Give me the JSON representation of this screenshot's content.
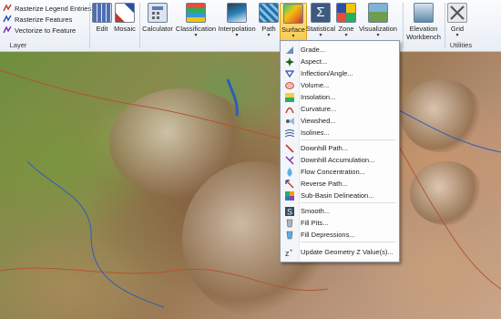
{
  "layer_group": {
    "items": [
      {
        "label": "Rasterize Legend Entries"
      },
      {
        "label": "Rasterize Features"
      },
      {
        "label": "Vectorize to Feature"
      }
    ],
    "group_label": "Layer"
  },
  "ribbon": {
    "buttons": [
      {
        "label": "Edit",
        "dropdown": false
      },
      {
        "label": "Mosaic",
        "dropdown": false
      },
      {
        "label": "Calculator",
        "dropdown": false
      },
      {
        "label": "Classification",
        "dropdown": true
      },
      {
        "label": "Interpolation",
        "dropdown": true
      },
      {
        "label": "Path",
        "dropdown": true
      },
      {
        "label": "Surface",
        "dropdown": true
      },
      {
        "label": "Statistical",
        "dropdown": true
      },
      {
        "label": "Zone",
        "dropdown": true
      },
      {
        "label": "Visualization",
        "dropdown": true
      },
      {
        "label": "Elevation Workbench",
        "dropdown": false
      },
      {
        "label": "Grid",
        "dropdown": true
      }
    ],
    "utilities_label": "Utilities"
  },
  "surface_menu": {
    "items": [
      {
        "label": "Grade...",
        "icon": "grade-icon"
      },
      {
        "label": "Aspect...",
        "icon": "aspect-icon"
      },
      {
        "label": "Inflection/Angle...",
        "icon": "inflection-icon"
      },
      {
        "label": "Volume...",
        "icon": "volume-icon"
      },
      {
        "label": "Insolation...",
        "icon": "insolation-icon"
      },
      {
        "label": "Curvature...",
        "icon": "curvature-icon"
      },
      {
        "label": "Viewshed...",
        "icon": "viewshed-icon"
      },
      {
        "label": "Isolines...",
        "icon": "isolines-icon"
      },
      {
        "label": "Downhill Path...",
        "icon": "downhill-path-icon"
      },
      {
        "label": "Downhill Accumulation...",
        "icon": "downhill-accumulation-icon"
      },
      {
        "label": "Flow Concentration...",
        "icon": "flow-concentration-icon"
      },
      {
        "label": "Reverse Path...",
        "icon": "reverse-path-icon"
      },
      {
        "label": "Sub-Basin Delineation...",
        "icon": "sub-basin-icon"
      },
      {
        "label": "Smooth...",
        "icon": "smooth-icon"
      },
      {
        "label": "Fill Pits...",
        "icon": "fill-pits-icon"
      },
      {
        "label": "Fill Depressions...",
        "icon": "fill-depressions-icon"
      },
      {
        "label": "Update Geometry Z Value(s)...",
        "icon": "update-z-icon"
      }
    ]
  },
  "colors": {
    "active_button": "#f7c94e",
    "menu_border": "#8c9aad",
    "river": "#2f5db8"
  }
}
